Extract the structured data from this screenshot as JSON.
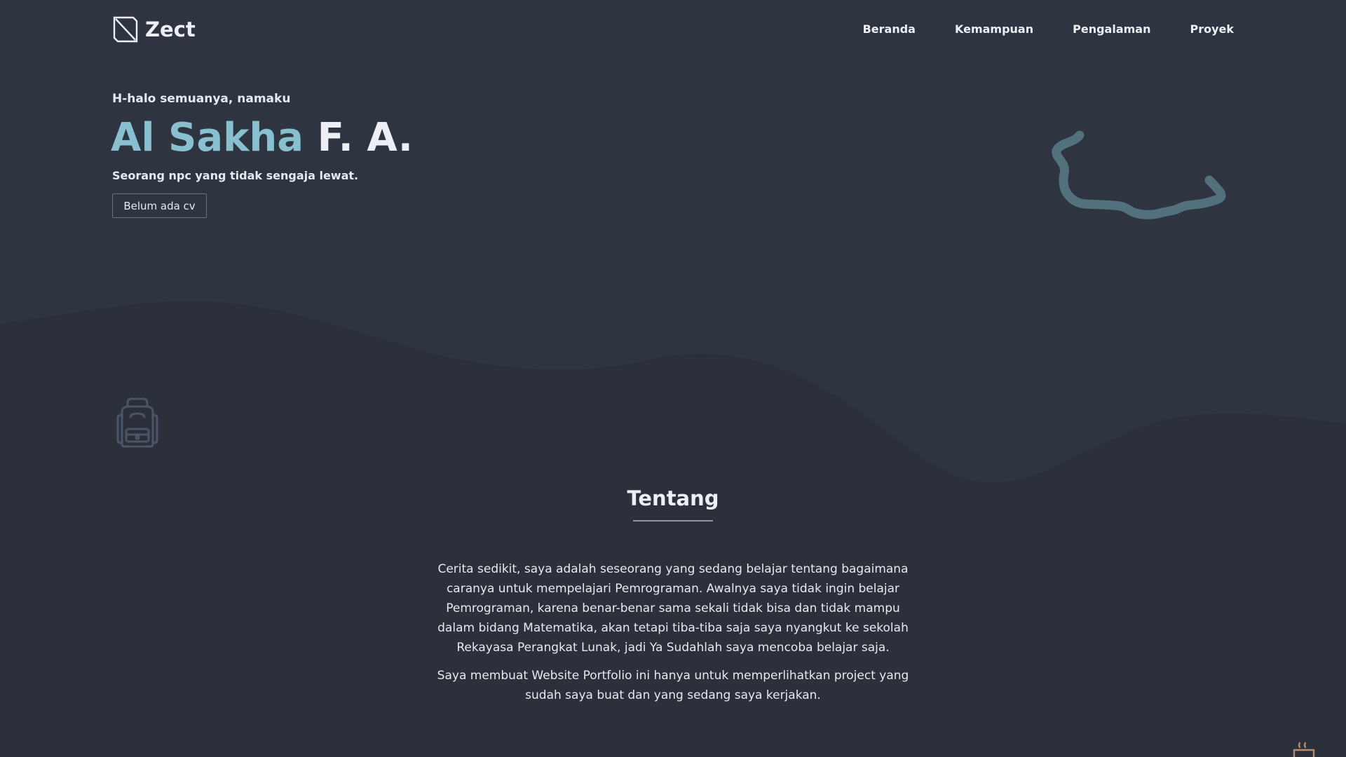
{
  "brand": {
    "name": "Zect"
  },
  "nav": {
    "items": [
      "Beranda",
      "Kemampuan",
      "Pengalaman",
      "Proyek"
    ]
  },
  "hero": {
    "greeting": "H-halo semuanya, namaku",
    "name_highlight": "Al Sakha",
    "name_rest": "F. A.",
    "tagline": "Seorang npc yang tidak sengaja lewat.",
    "cv_button": "Belum ada cv"
  },
  "about": {
    "title": "Tentang",
    "paragraphs": [
      "Cerita sedikit, saya adalah seseorang yang sedang belajar tentang bagaimana caranya untuk mempelajari Pemrograman. Awalnya saya tidak ingin belajar Pemrograman, karena benar-benar sama sekali tidak bisa dan tidak mampu dalam bidang Matematika, akan tetapi tiba-tiba saja saya nyangkut ke sekolah Rekayasa Perangkat Lunak, jadi Ya Sudahlah saya mencoba belajar saja.",
      "Saya membuat Website Portfolio ini hanya untuk memperlihatkan project yang sudah saya buat dan yang sedang saya kerjakan."
    ]
  },
  "icons": {
    "logo": "logo-icon",
    "decoration_left": "backpack-icon",
    "decoration_right": "coffee-cup-icon",
    "hero_decoration": "squiggle-line"
  },
  "colors": {
    "background": "#2e3440",
    "wave": "#2b303b",
    "accent": "#88c0d0",
    "squiggle": "#52717d",
    "text": "#eceff4"
  }
}
